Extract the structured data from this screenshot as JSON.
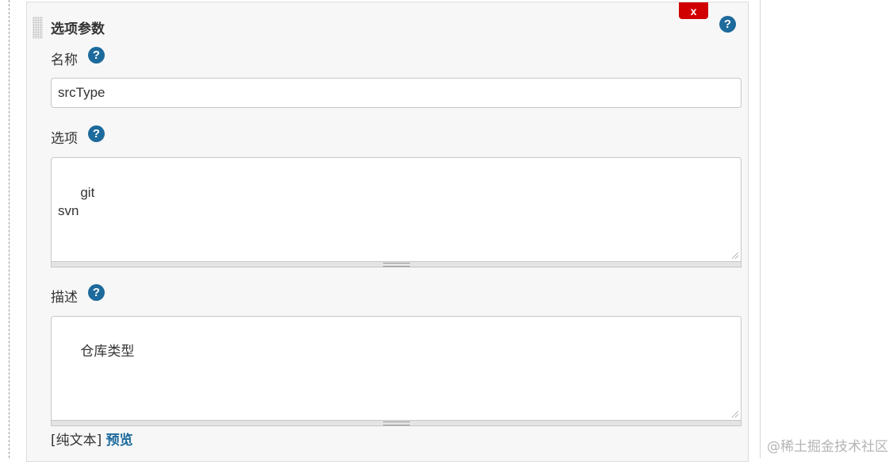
{
  "parameter_block": {
    "title": "选项参数",
    "delete_label": "x",
    "help_glyph": "?",
    "colors": {
      "delete": "#d10000",
      "help": "#1d6a9c",
      "link": "#1d6a9c"
    }
  },
  "fields": {
    "name": {
      "label": "名称",
      "value": "srcType"
    },
    "choices": {
      "label": "选项",
      "value": "git\nsvn"
    },
    "description": {
      "label": "描述",
      "value": "仓库类型"
    }
  },
  "format": {
    "plain_text": "[纯文本]",
    "preview_link": "预览"
  },
  "watermark": "@稀土掘金技术社区"
}
